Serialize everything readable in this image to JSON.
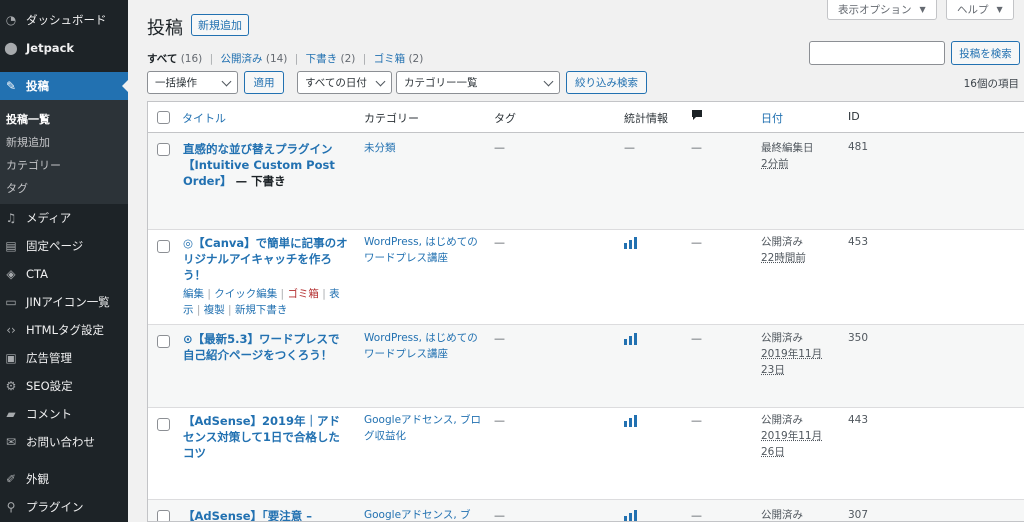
{
  "sidebar": {
    "items": [
      {
        "label": "ダッシュボード",
        "icon": "dashboard-icon"
      },
      {
        "label": "Jetpack",
        "icon": "jetpack-icon"
      },
      {
        "label": "投稿",
        "icon": "posts-icon"
      },
      {
        "label": "メディア",
        "icon": "media-icon"
      },
      {
        "label": "固定ページ",
        "icon": "pages-icon"
      },
      {
        "label": "CTA",
        "icon": "cta-icon"
      },
      {
        "label": "JINアイコン一覧",
        "icon": "jin-icon"
      },
      {
        "label": "HTMLタグ設定",
        "icon": "code-icon"
      },
      {
        "label": "広告管理",
        "icon": "ad-icon"
      },
      {
        "label": "SEO設定",
        "icon": "gear-icon"
      },
      {
        "label": "コメント",
        "icon": "comment-icon"
      },
      {
        "label": "お問い合わせ",
        "icon": "mail-icon"
      },
      {
        "label": "外観",
        "icon": "brush-icon"
      },
      {
        "label": "プラグイン",
        "icon": "plugin-icon"
      }
    ],
    "submenu": [
      "投稿一覧",
      "新規追加",
      "カテゴリー",
      "タグ"
    ]
  },
  "screen_meta": {
    "options": "表示オプション",
    "help": "ヘルプ"
  },
  "header": {
    "title": "投稿",
    "add_new": "新規追加"
  },
  "views": {
    "all": "すべて",
    "all_count": "(16)",
    "publish": "公開済み",
    "publish_count": "(14)",
    "draft": "下書き",
    "draft_count": "(2)",
    "trash": "ゴミ箱",
    "trash_count": "(2)"
  },
  "filters": {
    "bulk_action": "一括操作",
    "apply": "適用",
    "all_dates": "すべての日付",
    "category": "カテゴリー一覧",
    "filter": "絞り込み検索",
    "search_button": "投稿を検索",
    "item_count": "16個の項目"
  },
  "table": {
    "headers": {
      "title": "タイトル",
      "category": "カテゴリー",
      "tags": "タグ",
      "stats": "統計情報",
      "date": "日付",
      "id": "ID"
    },
    "dash": "—",
    "rows": [
      {
        "title": "直感的な並び替えプラグイン【Intuitive Custom Post Order】",
        "state": " — 下書き",
        "category": "未分類",
        "date_status": "最終編集日",
        "date_value": "2分前",
        "id": "481"
      },
      {
        "title": "◎【Canva】で簡単に記事のオリジナルアイキャッチを作ろう！",
        "category": "WordPress, はじめてのワードプレス講座",
        "date_status": "公開済み",
        "date_value": "22時間前",
        "id": "453",
        "actions": {
          "edit": "編集",
          "quick_edit": "クイック編集",
          "trash": "ゴミ箱",
          "view_1": "表",
          "view_2": "示",
          "duplicate": "複製",
          "new_draft": "新規下書き"
        }
      },
      {
        "title": "⊙【最新5.3】ワードプレスで自己紹介ページをつくろう！",
        "category": "WordPress, はじめてのワードプレス講座",
        "date_status": "公開済み",
        "date_value": "2019年11月23日",
        "id": "350"
      },
      {
        "title": "【AdSense】2019年｜アドセンス対策して1日で合格したコツ",
        "category": "Googleアドセンス, ブログ収益化",
        "date_status": "公開済み",
        "date_value": "2019年11月26日",
        "id": "443"
      },
      {
        "title": "【AdSense】「要注意 –",
        "category": "Googleアドセンス, ブ",
        "date_status": "公開済み",
        "date_value": "",
        "id": "307"
      }
    ]
  },
  "colors": {
    "sidebar": "#1d2327",
    "accent": "#2271b1",
    "trash": "#b32d2e"
  }
}
